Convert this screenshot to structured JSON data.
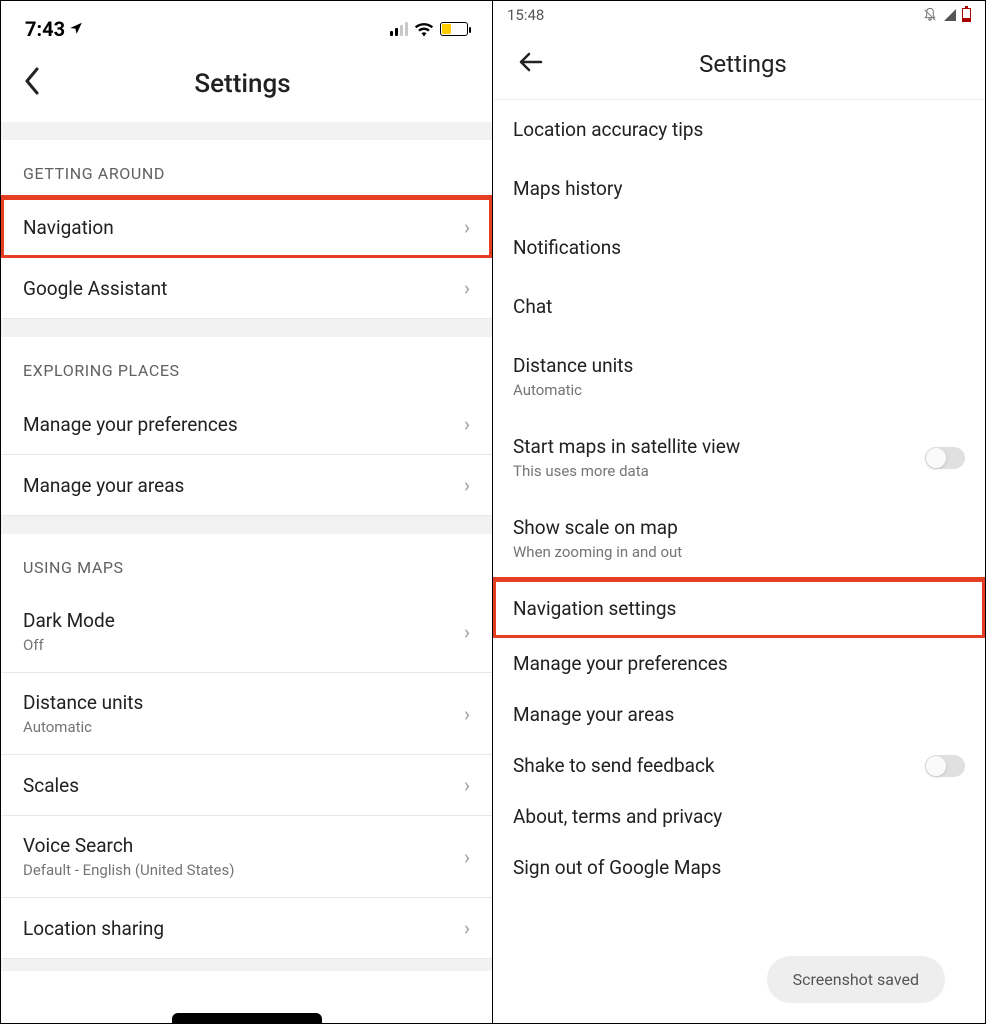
{
  "left": {
    "status": {
      "time": "7:43"
    },
    "header": {
      "title": "Settings"
    },
    "sections": {
      "getting_around": {
        "header": "GETTING AROUND",
        "items": [
          {
            "label": "Navigation"
          },
          {
            "label": "Google Assistant"
          }
        ]
      },
      "exploring_places": {
        "header": "EXPLORING PLACES",
        "items": [
          {
            "label": "Manage your preferences"
          },
          {
            "label": "Manage your areas"
          }
        ]
      },
      "using_maps": {
        "header": "USING MAPS",
        "items": [
          {
            "label": "Dark Mode",
            "sub": "Off"
          },
          {
            "label": "Distance units",
            "sub": "Automatic"
          },
          {
            "label": "Scales"
          },
          {
            "label": "Voice Search",
            "sub": "Default - English (United States)"
          },
          {
            "label": "Location sharing"
          }
        ]
      }
    }
  },
  "right": {
    "status": {
      "time": "15:48"
    },
    "header": {
      "title": "Settings"
    },
    "items": [
      {
        "label": "Location accuracy tips"
      },
      {
        "label": "Maps history"
      },
      {
        "label": "Notifications"
      },
      {
        "label": "Chat"
      },
      {
        "label": "Distance units",
        "sub": "Automatic"
      },
      {
        "label": "Start maps in satellite view",
        "sub": "This uses more data",
        "toggle": false
      },
      {
        "label": "Show scale on map",
        "sub": "When zooming in and out"
      },
      {
        "label": "Navigation settings"
      },
      {
        "label": "Manage your preferences"
      },
      {
        "label": "Manage your areas"
      },
      {
        "label": "Shake to send feedback",
        "toggle": false
      },
      {
        "label": "About, terms and privacy"
      },
      {
        "label": "Sign out of Google Maps"
      }
    ],
    "toast": "Screenshot saved"
  }
}
